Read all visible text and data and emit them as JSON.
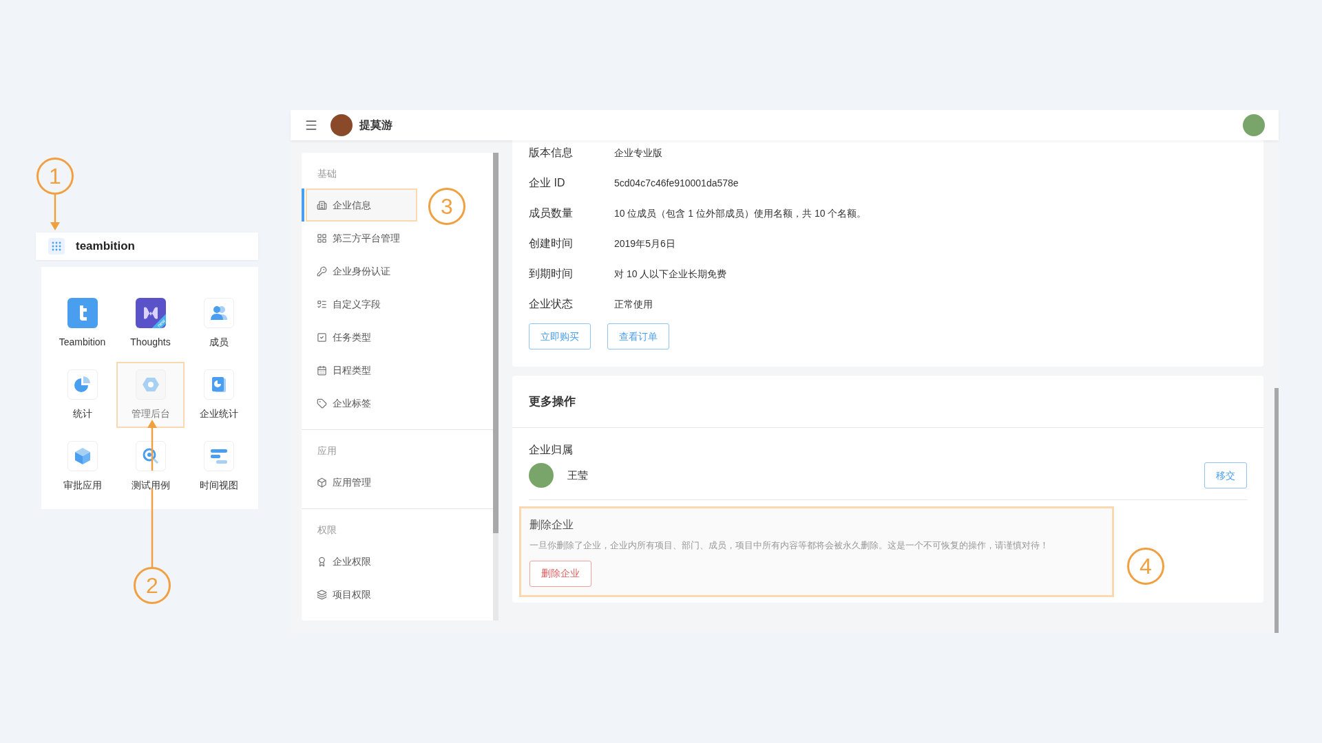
{
  "callouts": [
    {
      "label": "1"
    },
    {
      "label": "2"
    },
    {
      "label": "3"
    },
    {
      "label": "4"
    }
  ],
  "launcher": {
    "title": "teambition",
    "apps": [
      {
        "name": "Teambition",
        "highlighted": false
      },
      {
        "name": "Thoughts",
        "highlighted": false,
        "badge": "new"
      },
      {
        "name": "成员",
        "highlighted": false
      },
      {
        "name": "统计",
        "highlighted": false
      },
      {
        "name": "管理后台",
        "highlighted": true
      },
      {
        "name": "企业统计",
        "highlighted": false
      },
      {
        "name": "审批应用",
        "highlighted": false
      },
      {
        "name": "测试用例",
        "highlighted": false
      },
      {
        "name": "时间视图",
        "highlighted": false
      }
    ]
  },
  "admin": {
    "org_name": "提莫游",
    "sidebar": {
      "sections": [
        {
          "heading": "基础",
          "items": [
            {
              "label": "企业信息",
              "selected": true,
              "highlighted": true
            },
            {
              "label": "第三方平台管理",
              "selected": false,
              "highlighted": false
            },
            {
              "label": "企业身份认证",
              "selected": false,
              "highlighted": false
            },
            {
              "label": "自定义字段",
              "selected": false,
              "highlighted": false
            },
            {
              "label": "任务类型",
              "selected": false,
              "highlighted": false
            },
            {
              "label": "日程类型",
              "selected": false,
              "highlighted": false
            },
            {
              "label": "企业标签",
              "selected": false,
              "highlighted": false
            }
          ]
        },
        {
          "heading": "应用",
          "items": [
            {
              "label": "应用管理",
              "selected": false,
              "highlighted": false
            }
          ]
        },
        {
          "heading": "权限",
          "items": [
            {
              "label": "企业权限",
              "selected": false,
              "highlighted": false
            },
            {
              "label": "项目权限",
              "selected": false,
              "highlighted": false
            }
          ]
        }
      ]
    },
    "info": {
      "rows": [
        {
          "label": "版本信息",
          "value": "企业专业版"
        },
        {
          "label": "企业 ID",
          "value": "5cd04c7c46fe910001da578e"
        },
        {
          "label": "成员数量",
          "value": "10 位成员（包含 1 位外部成员）使用名额，共 10 个名额。"
        },
        {
          "label": "创建时间",
          "value": "2019年5月6日"
        },
        {
          "label": "到期时间",
          "value": "对 10 人以下企业长期免费"
        },
        {
          "label": "企业状态",
          "value": "正常使用"
        }
      ],
      "buttons": [
        "立即购买",
        "查看订单"
      ]
    },
    "more": {
      "title": "更多操作",
      "ownership": {
        "heading": "企业归属",
        "owner": "王莹",
        "button": "移交"
      },
      "delete": {
        "heading": "删除企业",
        "description": "一旦你删除了企业，企业内所有项目、部门、成员，项目中所有内容等都将会被永久删除。这是一个不可恢复的操作，请谨慎对待！",
        "button": "删除企业",
        "highlighted": true
      }
    }
  }
}
